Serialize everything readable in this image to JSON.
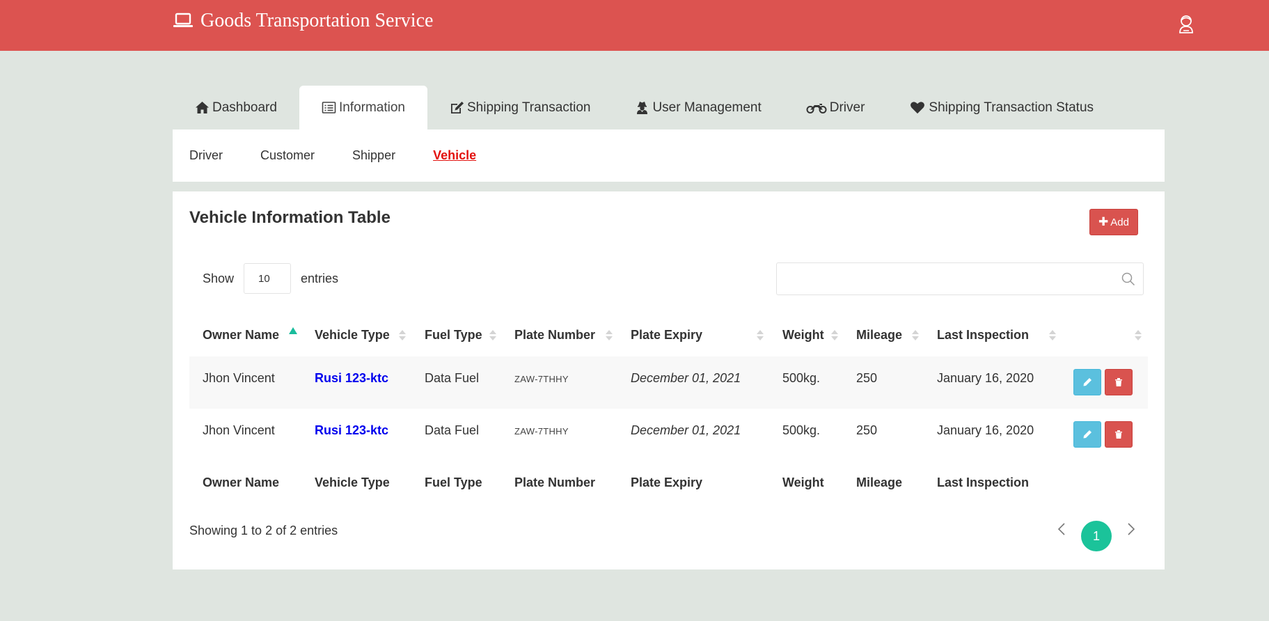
{
  "header": {
    "title": "Goods Transportation Service",
    "brand_icon": "laptop-icon",
    "user_icon": "user-avatar-icon",
    "color": "#dc5350"
  },
  "tabs": [
    {
      "label": "Dashboard",
      "icon": "home-icon",
      "active": false
    },
    {
      "label": "Information",
      "icon": "list-alt-icon",
      "active": true
    },
    {
      "label": "Shipping Transaction",
      "icon": "edit-icon",
      "active": false
    },
    {
      "label": "User Management",
      "icon": "user-secret-icon",
      "active": false
    },
    {
      "label": "Driver",
      "icon": "motorcycle-icon",
      "active": false
    },
    {
      "label": "Shipping Transaction Status",
      "icon": "heart-icon",
      "active": false
    }
  ],
  "subnav": [
    {
      "label": "Driver",
      "active": false
    },
    {
      "label": "Customer",
      "active": false
    },
    {
      "label": "Shipper",
      "active": false
    },
    {
      "label": "Vehicle",
      "active": true
    }
  ],
  "card": {
    "title": "Vehicle Information Table",
    "add_label": "Add"
  },
  "length_menu": {
    "show": "Show",
    "value": "10",
    "entries": "entries"
  },
  "search": {
    "value": "",
    "placeholder": ""
  },
  "table": {
    "columns": [
      "Owner Name",
      "Vehicle Type",
      "Fuel Type",
      "Plate Number",
      "Plate Expiry",
      "Weight",
      "Mileage",
      "Last Inspection"
    ],
    "sorted_column": "Owner Name",
    "rows": [
      [
        "Jhon Vincent",
        "Rusi 123-ktc",
        "Data Fuel",
        "ZAW-7THHY",
        "December 01, 2021",
        "500kg.",
        "250",
        "January 16, 2020"
      ],
      [
        "Jhon Vincent",
        "Rusi 123-ktc",
        "Data Fuel",
        "ZAW-7THHY",
        "December 01, 2021",
        "500kg.",
        "250",
        "January 16, 2020"
      ]
    ]
  },
  "footer": {
    "info": "Showing 1 to 2 of 2 entries",
    "current_page": "1"
  },
  "colors": {
    "accent": "#1bc39a",
    "edit": "#5bc0de",
    "delete": "#d9534f",
    "active_subnav": "#e3120f",
    "link": "#0000ee"
  }
}
